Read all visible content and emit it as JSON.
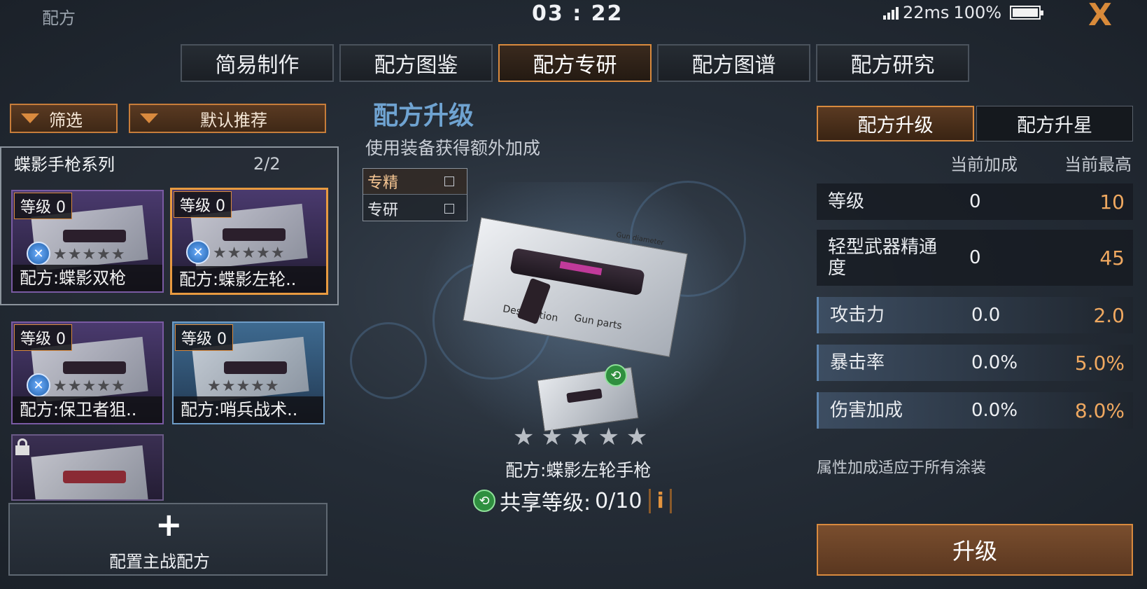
{
  "topbar": {
    "title": "配方",
    "clock": "03 : 22",
    "ping": "22ms",
    "battery": "100%",
    "close_label": "X"
  },
  "tabs": [
    "简易制作",
    "配方图鉴",
    "配方专研",
    "配方图谱",
    "配方研究"
  ],
  "active_tab": 2,
  "left": {
    "filter_label": "筛选",
    "sort_label": "默认推荐",
    "series_title": "蝶影手枪系列",
    "series_count": "2/2",
    "cards": [
      {
        "level": "等级 0",
        "name": "配方:蝶影双枪",
        "stars": "★★★★★"
      },
      {
        "level": "等级 0",
        "name": "配方:蝶影左轮..",
        "stars": "★★★★★"
      },
      {
        "level": "等级 0",
        "name": "配方:保卫者狙..",
        "stars": "★★★★★"
      },
      {
        "level": "等级 0",
        "name": "配方:哨兵战术..",
        "stars": "★★★★★"
      }
    ],
    "deploy_label": "配置主战配方",
    "deploy_plus": "+"
  },
  "center": {
    "title": "配方升级",
    "subtitle": "使用装备获得额外加成",
    "checks": [
      "专精",
      "专研"
    ],
    "paper_labels": [
      "Description",
      "Gun parts",
      "Gun diameter"
    ],
    "stars": "★★★★★",
    "recipe_name": "配方:蝶影左轮手枪",
    "share_label": "共享等级:",
    "share_value": "0/10",
    "info_label": "i"
  },
  "right": {
    "tab_upgrade": "配方升级",
    "tab_star": "配方升星",
    "col_current": "当前加成",
    "col_max": "当前最高",
    "stats": [
      {
        "label": "等级",
        "current": "0",
        "max": "10"
      },
      {
        "label": "轻型武器精通度",
        "current": "0",
        "max": "45"
      },
      {
        "label": "攻击力",
        "current": "0.0",
        "max": "2.0"
      },
      {
        "label": "暴击率",
        "current": "0.0%",
        "max": "5.0%"
      },
      {
        "label": "伤害加成",
        "current": "0.0%",
        "max": "8.0%"
      }
    ],
    "note": "属性加成适应于所有涂装",
    "upgrade_button": "升级"
  },
  "colors": {
    "accent": "#d98a3e",
    "title_blue": "#6fa3d1",
    "max_value": "#efa860"
  }
}
